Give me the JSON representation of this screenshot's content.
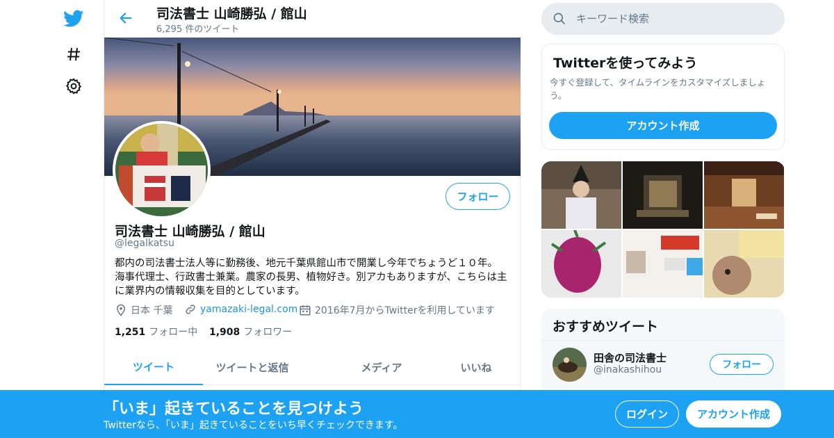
{
  "colors": {
    "accent": "#1da1f2",
    "text": "#14171a",
    "muted": "#657786",
    "border": "#e6ecf0"
  },
  "nav": {
    "items": [
      {
        "icon": "twitter-bird-icon"
      },
      {
        "icon": "hashtag-icon"
      },
      {
        "icon": "gear-icon"
      }
    ]
  },
  "header": {
    "title": "司法書士 山崎勝弘 / 館山",
    "tweet_count": "6,295 件のツイート"
  },
  "profile": {
    "follow_label": "フォロー",
    "name": "司法書士 山崎勝弘 / 館山",
    "handle": "@legalkatsu",
    "bio": "都内の司法書士法人等に勤務後、地元千葉県館山市で開業し今年でちょうど１０年。海事代理士、行政書士兼業。農家の長男、植物好き。別アカもありますが、こちらは主に業界内の情報収集を目的としています。",
    "location": "日本 千葉",
    "website": "yamazaki-legal.com",
    "joined": "2016年7月からTwitterを利用しています",
    "following_count": "1,251",
    "following_label": "フォロー中",
    "followers_count": "1,908",
    "followers_label": "フォロワー"
  },
  "tabs": [
    {
      "label": "ツイート",
      "active": true
    },
    {
      "label": "ツイートと返信",
      "active": false
    },
    {
      "label": "メディア",
      "active": false
    },
    {
      "label": "いいね",
      "active": false
    }
  ],
  "search": {
    "placeholder": "キーワード検索"
  },
  "signup_card": {
    "title": "Twitterを使ってみよう",
    "description": "今すぐ登録して、タイムラインをカスタマイズしましょう。",
    "button": "アカウント作成"
  },
  "recommended": {
    "title": "おすすめツイート",
    "user": {
      "name": "田舎の司法書士",
      "handle": "@inakashihou",
      "follow_label": "フォロー"
    }
  },
  "bottom_bar": {
    "title": "「いま」起きていることを見つけよう",
    "subtitle": "Twitterなら、「いま」起きていることをいち早くチェックできます。",
    "login": "ログイン",
    "signup": "アカウント作成"
  }
}
